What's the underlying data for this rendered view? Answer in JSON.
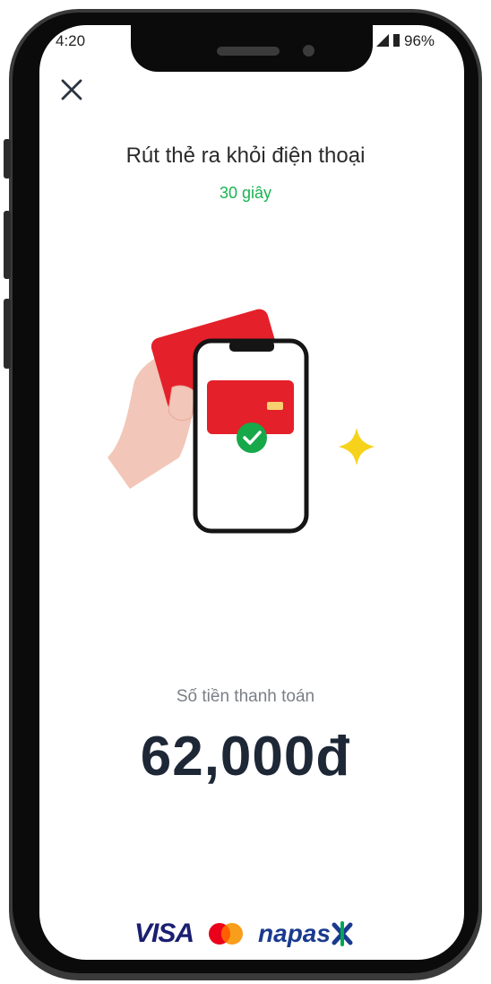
{
  "status_bar": {
    "time": "4:20",
    "battery": "96%"
  },
  "header": {
    "title": "Rút thẻ ra khỏi điện thoại",
    "countdown": "30 giây"
  },
  "payment": {
    "label": "Số tiền thanh toán",
    "amount": "62,000đ"
  },
  "brands": {
    "visa": "VISA",
    "mastercard": "mastercard-logo",
    "napas": "napas"
  },
  "colors": {
    "accent_green": "#19b451",
    "card_red": "#e4202a",
    "sparkle_yellow": "#f7d21b",
    "amount_text": "#1d2736"
  },
  "icons": {
    "close": "close-icon",
    "check": "check-icon",
    "sparkle": "sparkle-icon"
  }
}
